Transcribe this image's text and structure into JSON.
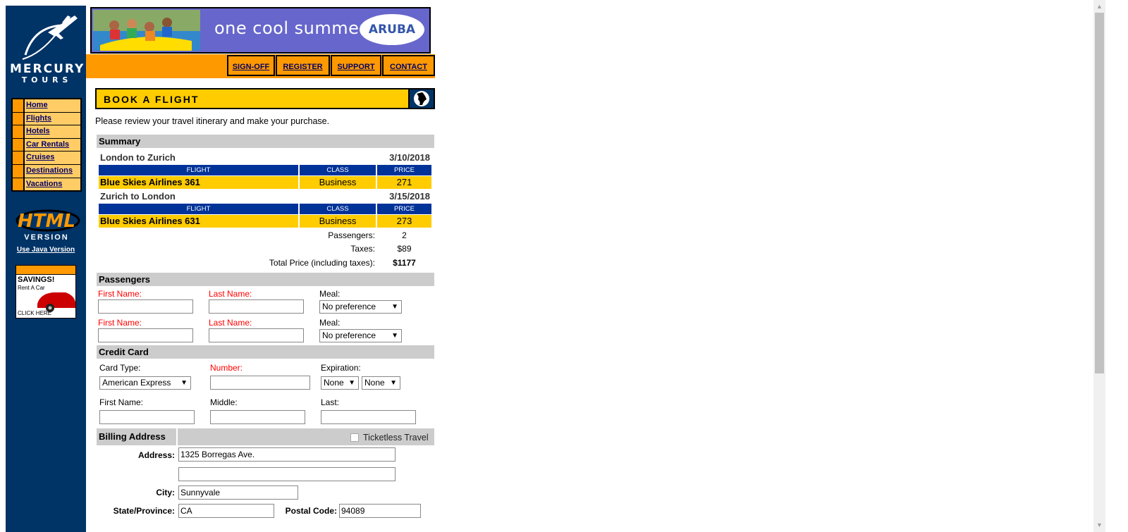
{
  "brand": {
    "line1": "MERCURY",
    "line2": "T O U R S"
  },
  "nav": {
    "items": [
      {
        "label": "Home"
      },
      {
        "label": "Flights"
      },
      {
        "label": "Hotels"
      },
      {
        "label": "Car Rentals"
      },
      {
        "label": "Cruises"
      },
      {
        "label": "Destinations"
      },
      {
        "label": "Vacations"
      }
    ]
  },
  "badge": {
    "html": "HTML",
    "version": "VERSION",
    "java_link": "Use Java Version"
  },
  "ad": {
    "title": "SAVINGS!",
    "sub": "Rent A Car",
    "cta": "CLICK HERE"
  },
  "banner": {
    "text": "one cool summer",
    "brand": "ARUBA"
  },
  "topnav": {
    "signoff": "SIGN-OFF",
    "register": "REGISTER",
    "support": "SUPPORT",
    "contact": "CONTACT"
  },
  "page": {
    "title": "BOOK A FLIGHT",
    "intro": "Please review your travel itinerary and make your purchase."
  },
  "summary": {
    "header": "Summary",
    "col_flight": "FLIGHT",
    "col_class": "CLASS",
    "col_price": "PRICE",
    "legs": [
      {
        "route": "London to Zurich",
        "date": "3/10/2018",
        "flight": "Blue Skies Airlines 361",
        "class": "Business",
        "price": "271"
      },
      {
        "route": "Zurich to London",
        "date": "3/15/2018",
        "flight": "Blue Skies Airlines 631",
        "class": "Business",
        "price": "273"
      }
    ],
    "passengers_label": "Passengers:",
    "passengers": "2",
    "taxes_label": "Taxes:",
    "taxes": "$89",
    "total_label": "Total Price (including taxes):",
    "total": "$1177"
  },
  "passengers": {
    "header": "Passengers",
    "first_label": "First Name:",
    "last_label": "Last Name:",
    "meal_label": "Meal:",
    "meal_value": "No preference"
  },
  "credit": {
    "header": "Credit Card",
    "type_label": "Card Type:",
    "type_value": "American Express",
    "number_label": "Number:",
    "exp_label": "Expiration:",
    "exp_month": "None",
    "exp_year": "None",
    "first_label": "First Name:",
    "middle_label": "Middle:",
    "last_label": "Last:"
  },
  "billing": {
    "header": "Billing Address",
    "ticketless": "Ticketless Travel",
    "address_label": "Address:",
    "address1": "1325 Borregas Ave.",
    "address2": "",
    "city_label": "City:",
    "city": "Sunnyvale",
    "state_label": "State/Province:",
    "state": "CA",
    "postal_label": "Postal Code:",
    "postal": "94089"
  },
  "colors": {
    "navy": "#003366",
    "orange": "#ff9900",
    "yellow": "#ffcc00",
    "blue_header": "#003399"
  }
}
